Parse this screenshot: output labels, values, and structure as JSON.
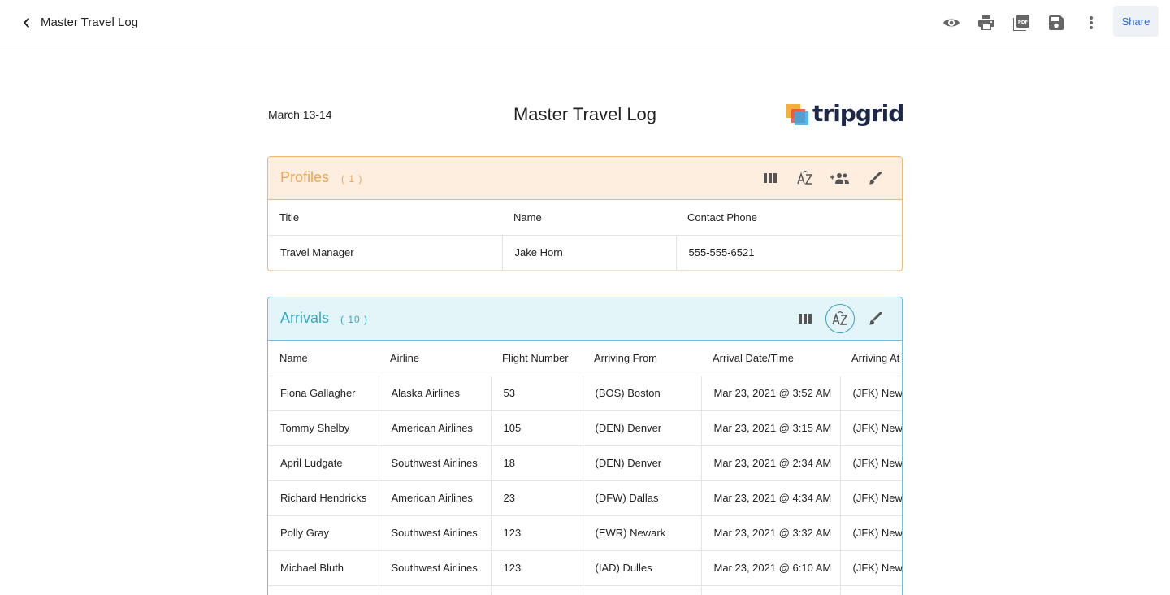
{
  "topbar": {
    "title": "Master Travel Log",
    "share_label": "Share",
    "icons": [
      "preview-icon",
      "print-icon",
      "pdf-icon",
      "save-icon",
      "more-vert-icon"
    ]
  },
  "document": {
    "date": "March 13-14",
    "title": "Master Travel Log",
    "logo_text": "tripgrid"
  },
  "profiles": {
    "title": "Profiles",
    "count": "( 1 )",
    "accent": "#f2a553",
    "columns": [
      "Title",
      "Name",
      "Contact Phone"
    ],
    "rows": [
      [
        "Travel Manager",
        "Jake Horn",
        "555-555-6521"
      ]
    ]
  },
  "arrivals": {
    "title": "Arrivals",
    "count": "( 10 )",
    "accent": "#39a8c4",
    "columns": [
      "Name",
      "Airline",
      "Flight Number",
      "Arriving From",
      "Arrival Date/Time",
      "Arriving At"
    ],
    "rows": [
      [
        "Fiona Gallagher",
        "Alaska Airlines",
        "53",
        "(BOS) Boston",
        "Mar 23, 2021 @ 3:52 AM",
        "(JFK) New"
      ],
      [
        "Tommy Shelby",
        "American Airlines",
        "105",
        "(DEN) Denver",
        "Mar 23, 2021 @ 3:15 AM",
        "(JFK) New"
      ],
      [
        "April Ludgate",
        "Southwest Airlines",
        "18",
        "(DEN) Denver",
        "Mar 23, 2021 @ 2:34 AM",
        "(JFK) New"
      ],
      [
        "Richard Hendricks",
        "American Airlines",
        "23",
        "(DFW) Dallas",
        "Mar 23, 2021 @ 4:34 AM",
        "(JFK) New"
      ],
      [
        "Polly Gray",
        "Southwest Airlines",
        "123",
        "(EWR) Newark",
        "Mar 23, 2021 @ 3:32 AM",
        "(JFK) New"
      ],
      [
        "Michael Bluth",
        "Southwest Airlines",
        "123",
        "(IAD) Dulles",
        "Mar 23, 2021 @ 6:10 AM",
        "(JFK) New"
      ],
      [
        "",
        "",
        "",
        "",
        "",
        ""
      ]
    ]
  }
}
